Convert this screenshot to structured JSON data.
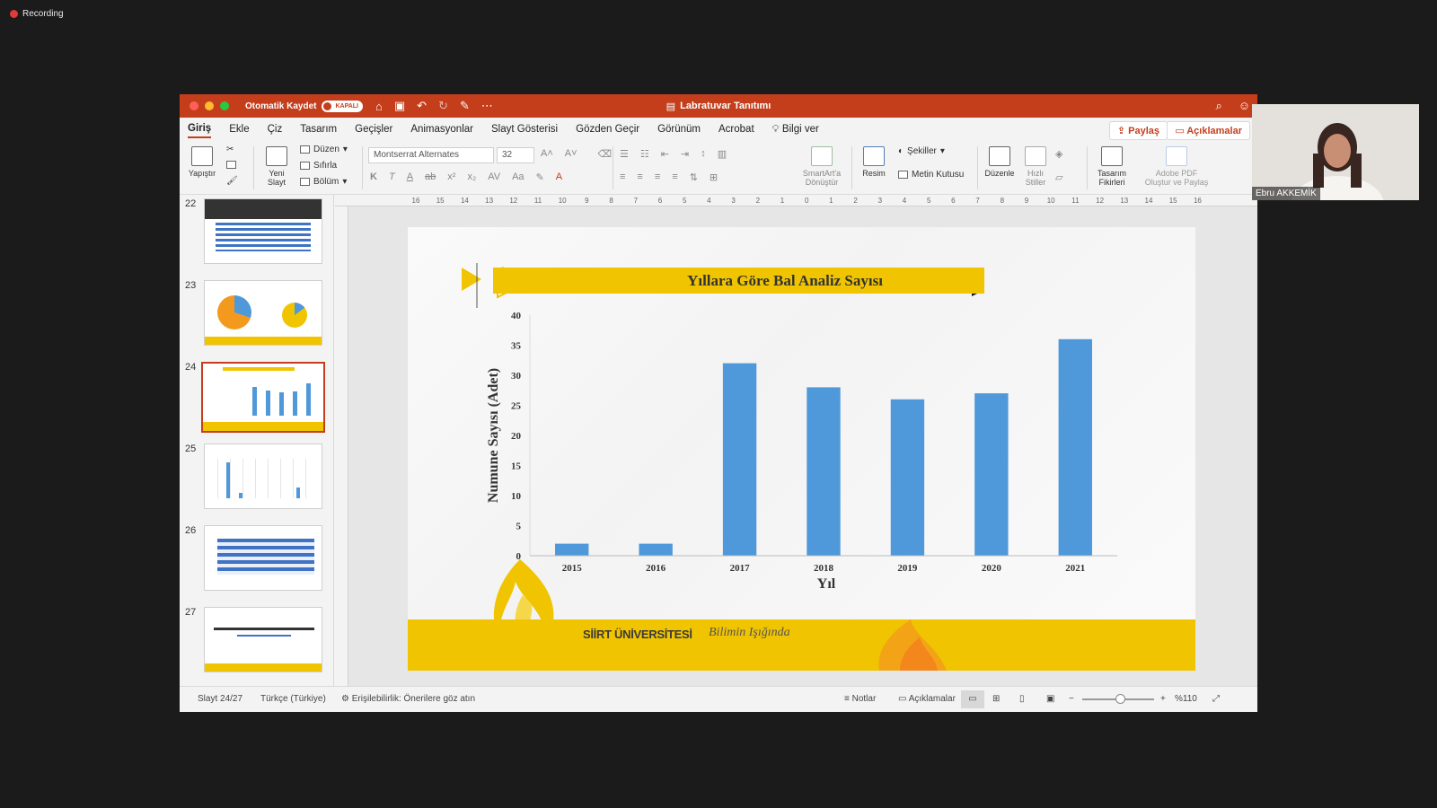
{
  "recording": {
    "label": "Recording"
  },
  "titlebar": {
    "autosave_label": "Otomatik Kaydet",
    "autosave_state": "KAPALI",
    "doc_title": "Labratuvar Tanıtımı"
  },
  "tabs": [
    {
      "label": "Giriş",
      "active": true
    },
    {
      "label": "Ekle"
    },
    {
      "label": "Çiz"
    },
    {
      "label": "Tasarım"
    },
    {
      "label": "Geçişler"
    },
    {
      "label": "Animasyonlar"
    },
    {
      "label": "Slayt Gösterisi"
    },
    {
      "label": "Gözden Geçir"
    },
    {
      "label": "Görünüm"
    },
    {
      "label": "Acrobat"
    },
    {
      "label": "Bilgi ver"
    }
  ],
  "share": {
    "label": "Paylaş"
  },
  "comments": {
    "label": "Açıklamalar"
  },
  "ribbon": {
    "paste": "Yapıştır",
    "new_slide_1": "Yeni",
    "new_slide_2": "Slayt",
    "layout": "Düzen",
    "reset": "Sıfırla",
    "section": "Bölüm",
    "font_name": "Montserrat Alternates",
    "font_size": "32",
    "smartart_1": "SmartArt'a",
    "smartart_2": "Dönüştür",
    "picture": "Resim",
    "shapes": "Şekiller",
    "textbox": "Metin Kutusu",
    "arrange": "Düzenle",
    "quick_styles_1": "Hızlı",
    "quick_styles_2": "Stiller",
    "designer_1": "Tasarım",
    "designer_2": "Fikirleri",
    "adobe_1": "Adobe PDF",
    "adobe_2": "Oluştur ve Paylaş"
  },
  "thumbnails": [
    {
      "num": "22"
    },
    {
      "num": "23"
    },
    {
      "num": "24",
      "selected": true
    },
    {
      "num": "25"
    },
    {
      "num": "26"
    },
    {
      "num": "27"
    }
  ],
  "ruler": {
    "h_ticks": [
      "16",
      "15",
      "14",
      "13",
      "12",
      "11",
      "10",
      "9",
      "8",
      "7",
      "6",
      "5",
      "4",
      "3",
      "2",
      "1",
      "0",
      "1",
      "2",
      "3",
      "4",
      "5",
      "6",
      "7",
      "8",
      "9",
      "10",
      "11",
      "12",
      "13",
      "14",
      "15",
      "16"
    ]
  },
  "slide": {
    "title": "Yıllara Göre Bal Analiz Sayısı",
    "university": "SİİRT ÜNİVERSİTESİ",
    "motto": "Bilimin Işığında"
  },
  "chart_data": {
    "type": "bar",
    "categories": [
      "2015",
      "2016",
      "2017",
      "2018",
      "2019",
      "2020",
      "2021"
    ],
    "values": [
      2,
      2,
      32,
      28,
      26,
      27,
      36
    ],
    "xlabel": "Yıl",
    "ylabel": "Numune Sayısı (Adet)",
    "ylim": [
      0,
      40
    ],
    "yticks": [
      0,
      5,
      10,
      15,
      20,
      25,
      30,
      35,
      40
    ],
    "color": "#4f98da",
    "grid": false
  },
  "status": {
    "slide": "Slayt 24/27",
    "language": "Türkçe (Türkiye)",
    "accessibility": "Erişilebilirlik: Önerilere göz atın",
    "notes": "Notlar",
    "comments": "Açıklamalar",
    "zoom": "%110"
  },
  "webcam": {
    "name": "Ebru AKKEMİK"
  },
  "colors": {
    "accent": "#c43e1c",
    "banner": "#f0c400",
    "bar": "#4f98da"
  }
}
